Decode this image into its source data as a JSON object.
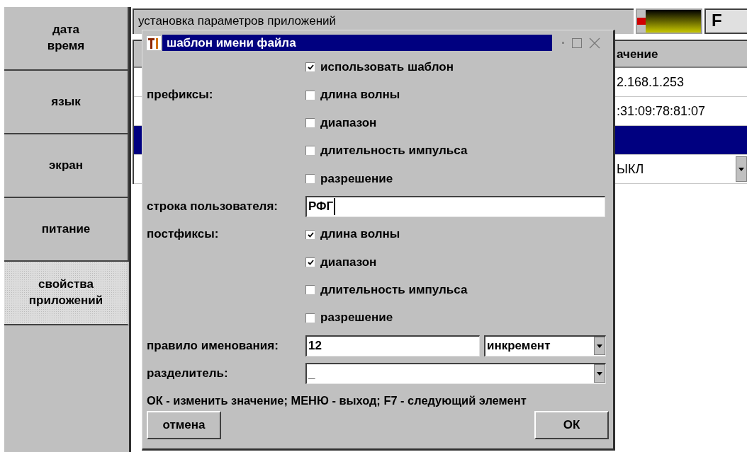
{
  "sidebar": {
    "items": [
      {
        "label": "дата\nвремя",
        "selected": false
      },
      {
        "label": "язык",
        "selected": false
      },
      {
        "label": "экран",
        "selected": false
      },
      {
        "label": "питание",
        "selected": false
      },
      {
        "label": "свойства\nприложений",
        "selected": true
      }
    ]
  },
  "header": {
    "title": "установка параметров приложений",
    "f_button": "F"
  },
  "table": {
    "columns": [
      "ачение"
    ],
    "rows": [
      {
        "kind": "text",
        "selected": false,
        "value": "2.168.1.253"
      },
      {
        "kind": "text",
        "selected": false,
        "value": ":31:09:78:81:07"
      },
      {
        "kind": "text",
        "selected": true
      },
      {
        "kind": "dropdown",
        "selected": false,
        "value": "ЫКЛ"
      }
    ]
  },
  "dialog": {
    "title": "шаблон имени файла",
    "rows": [
      {
        "kind": "checkbox",
        "text": "использовать шаблон",
        "checked": true
      },
      {
        "kind": "checkbox",
        "label": "префиксы:",
        "text": "длина волны",
        "checked": false
      },
      {
        "kind": "checkbox",
        "text": "диапазон",
        "checked": false
      },
      {
        "kind": "checkbox",
        "text": "длительность импульса",
        "checked": false
      },
      {
        "kind": "checkbox",
        "text": "разрешение",
        "checked": false
      },
      {
        "kind": "input",
        "label": "строка пользователя:",
        "value": "РФГ",
        "focused": true
      },
      {
        "kind": "checkbox",
        "label": "постфиксы:",
        "text": "длина волны",
        "checked": true
      },
      {
        "kind": "checkbox",
        "text": "диапазон",
        "checked": true
      },
      {
        "kind": "checkbox",
        "text": "длительность импульса",
        "checked": false
      },
      {
        "kind": "checkbox",
        "text": "разрешение",
        "checked": false
      },
      {
        "kind": "input_select",
        "label": "правило именования:",
        "value": "12",
        "option": "инкремент"
      },
      {
        "kind": "select",
        "label": "разделитель:",
        "value": "_"
      }
    ],
    "hint": "ОК - изменить значение; МЕНЮ - выход; F7 - следующий элемент",
    "buttons": [
      {
        "label": "отмена"
      },
      {
        "label": "ОК"
      }
    ]
  }
}
